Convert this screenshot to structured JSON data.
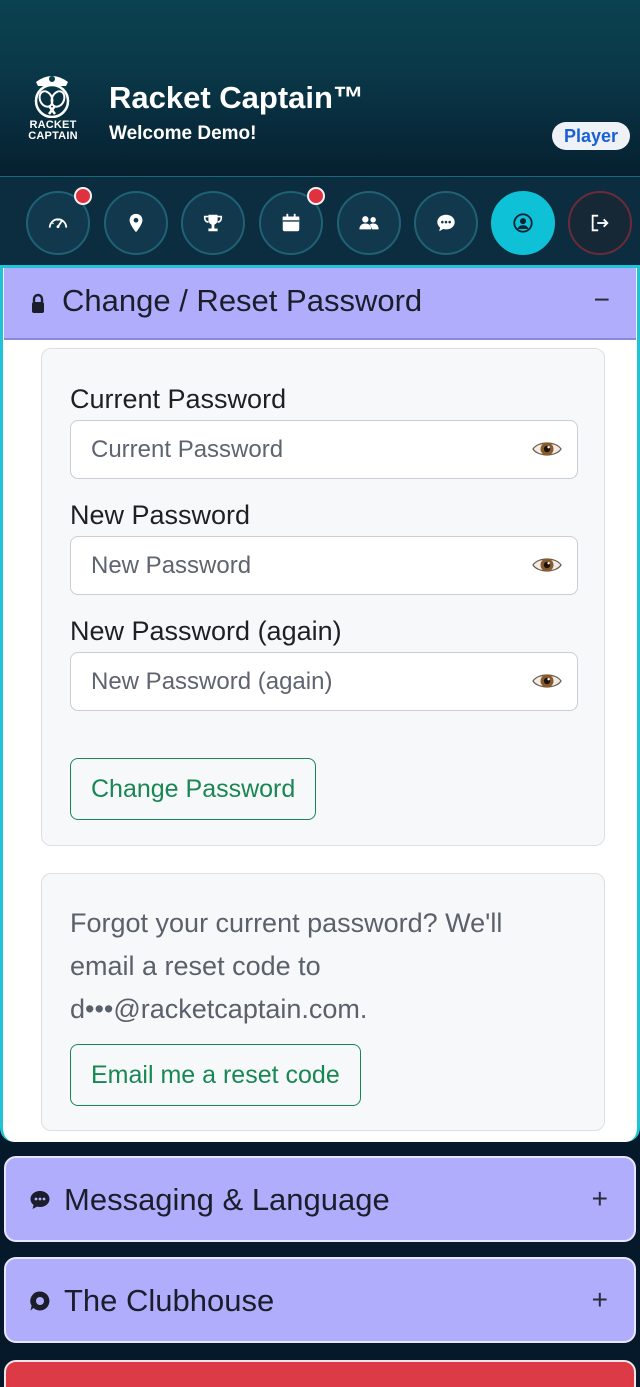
{
  "header": {
    "logo_line1": "RACKET",
    "logo_line2": "CAPTAIN",
    "brand": "Racket Captain™",
    "welcome": "Welcome Demo!",
    "role_badge": "Player"
  },
  "nav": {
    "items": [
      {
        "icon": "gauge-icon",
        "badge": true
      },
      {
        "icon": "location-pin-icon",
        "badge": false
      },
      {
        "icon": "trophy-icon",
        "badge": false
      },
      {
        "icon": "calendar-icon",
        "badge": true
      },
      {
        "icon": "people-icon",
        "badge": false
      },
      {
        "icon": "chat-icon",
        "badge": false
      },
      {
        "icon": "profile-icon",
        "badge": false,
        "active": true
      },
      {
        "icon": "logout-icon",
        "badge": false
      }
    ]
  },
  "change_password": {
    "title": "Change / Reset Password",
    "toggle": "−",
    "current_label": "Current Password",
    "current_placeholder": "Current Password",
    "new_label": "New Password",
    "new_placeholder": "New Password",
    "again_label": "New Password (again)",
    "again_placeholder": "New Password (again)",
    "submit_label": "Change Password",
    "forgot_text": "Forgot your current password? We'll email a reset code to d•••@racketcaptain.com.",
    "reset_button": "Email me a reset code"
  },
  "sections": {
    "messaging": {
      "title": "Messaging & Language",
      "toggle": "+"
    },
    "clubhouse": {
      "title": "The Clubhouse",
      "toggle": "+"
    }
  },
  "colors": {
    "accent_cyan": "#0ec1d6",
    "section_header": "#b0aefc",
    "success_green": "#198754",
    "badge_red": "#e0323e"
  }
}
